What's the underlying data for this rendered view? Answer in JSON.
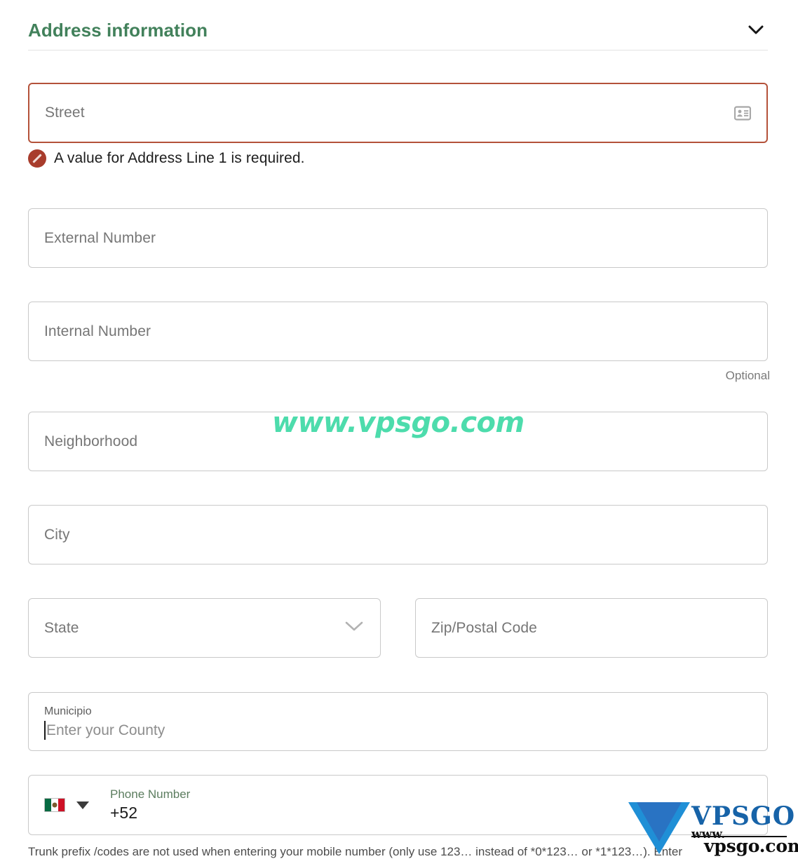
{
  "section": {
    "title": "Address information",
    "toggle_icon": "chevron-down-icon"
  },
  "fields": {
    "street": {
      "placeholder": "Street",
      "value": "",
      "state": "error",
      "trailing_icon": "address-card-icon",
      "error_message": "A value for Address Line 1 is required.",
      "error_icon": "ban-icon"
    },
    "external_number": {
      "placeholder": "External Number",
      "value": ""
    },
    "internal_number": {
      "placeholder": "Internal Number",
      "value": "",
      "hint": "Optional"
    },
    "neighborhood": {
      "placeholder": "Neighborhood",
      "value": ""
    },
    "city": {
      "placeholder": "City",
      "value": ""
    },
    "state": {
      "placeholder": "State",
      "value": "",
      "dropdown_icon": "chevron-down-icon"
    },
    "zip": {
      "placeholder": "Zip/Postal Code",
      "value": ""
    },
    "municipio": {
      "label": "Municipio",
      "placeholder": "Enter your County",
      "value": "",
      "focused": true
    },
    "phone": {
      "label": "Phone Number",
      "value": "+52",
      "country_flag": "mexico-flag-icon",
      "dropdown_icon": "caret-down-icon"
    }
  },
  "footer": {
    "note": "Trunk prefix /codes are not used when entering your mobile number (only use 123… instead of *0*123… or *1*123…). Enter"
  },
  "watermarks": {
    "text": "www.vpsgo.com",
    "logo_brand": "VPSGO",
    "logo_www": "www.",
    "logo_domain": "vpsgo.com"
  },
  "colors": {
    "title_green": "#42815b",
    "error_red": "#b4523a",
    "error_icon": "#a83c2c",
    "watermark_teal": "#4ddcac",
    "logo_blue": "#1763a8",
    "border_grey": "#c9c9c9",
    "placeholder_grey": "#767676"
  }
}
